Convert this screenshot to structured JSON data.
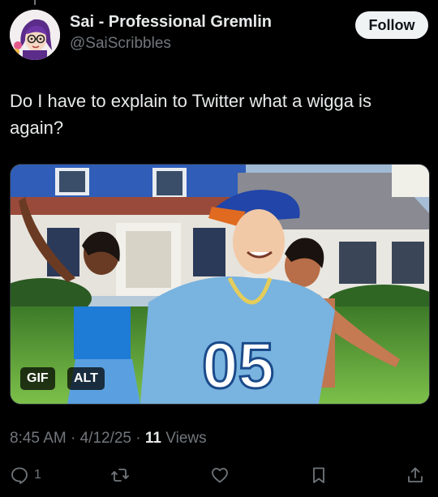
{
  "author": {
    "display_name": "Sai - Professional Gremlin",
    "handle": "@SaiScribbles",
    "avatar_icon": "cartoon-avatar"
  },
  "follow_label": "Follow",
  "tweet": {
    "text": "Do I have to explain to Twitter what a wigga is again?"
  },
  "media": {
    "type": "gif",
    "gif_badge": "GIF",
    "alt_badge": "ALT",
    "jersey_number": "05"
  },
  "meta": {
    "time": "8:45 AM",
    "separator": "·",
    "date": "4/12/25",
    "views_count": "11",
    "views_label": "Views"
  },
  "actions": {
    "reply_count": "1",
    "icons": [
      "reply-icon",
      "repost-icon",
      "like-icon",
      "bookmark-icon",
      "share-icon"
    ]
  },
  "colors": {
    "background": "#000000",
    "text": "#e7e9ea",
    "muted": "#71767b",
    "follow_bg": "#eff3f4"
  }
}
